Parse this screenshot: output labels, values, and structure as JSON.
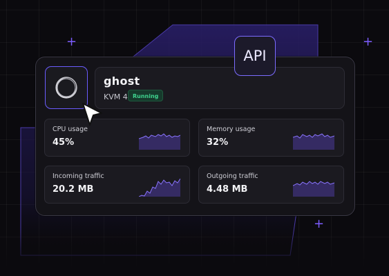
{
  "server": {
    "name": "ghost",
    "plan": "KVM 4",
    "status": "Running"
  },
  "api_badge": "API",
  "metrics": [
    {
      "label": "CPU usage",
      "value": "45%"
    },
    {
      "label": "Memory usage",
      "value": "32%"
    },
    {
      "label": "Incoming traffic",
      "value": "20.2 MB"
    },
    {
      "label": "Outgoing traffic",
      "value": "4.48 MB"
    }
  ],
  "colors": {
    "accent": "#7c5cff",
    "status_green": "#3fd28e",
    "background": "#0b0a0e"
  },
  "icons": [
    "ring-logo-icon",
    "cursor-pointer-icon",
    "plus-sparkle-icon"
  ]
}
